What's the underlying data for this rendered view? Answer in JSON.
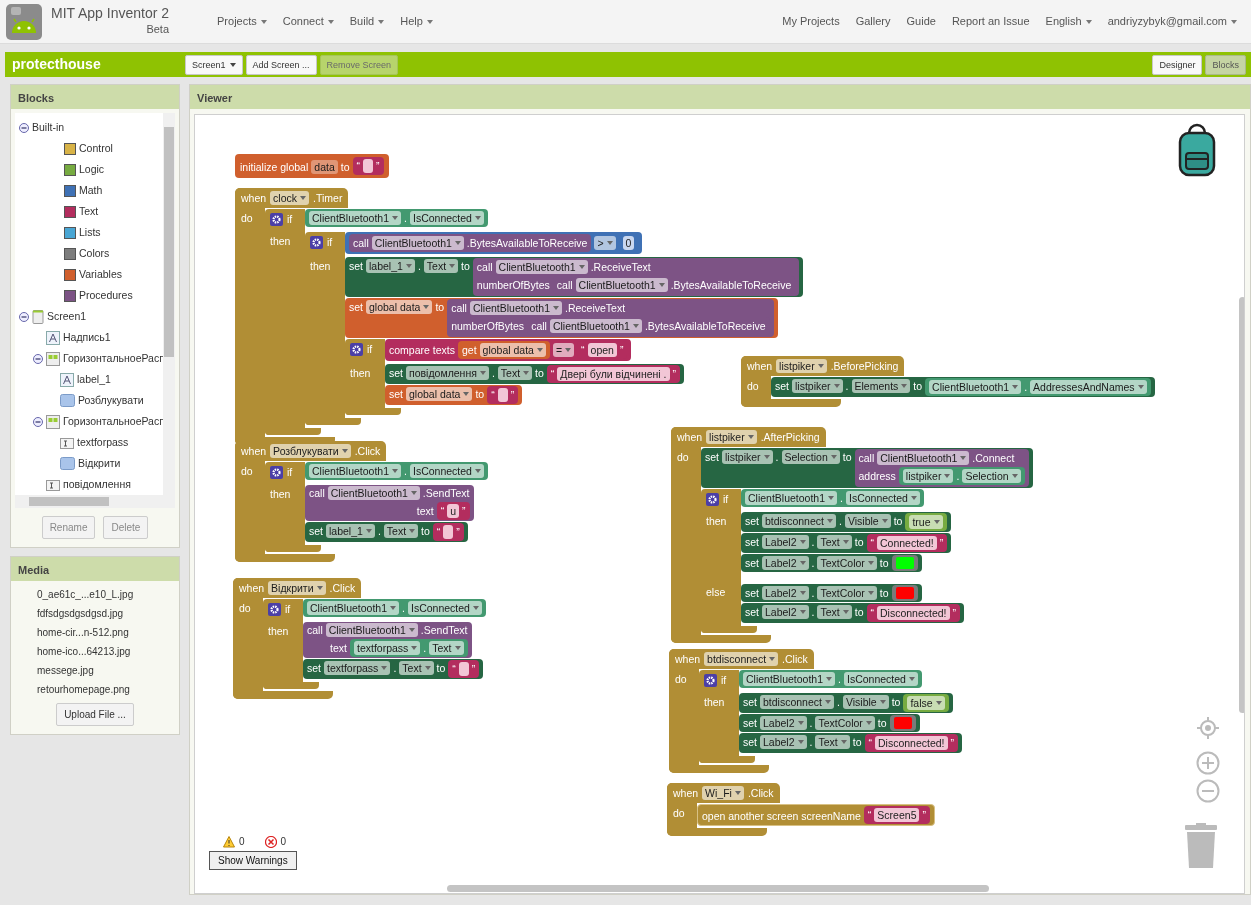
{
  "nav": {
    "title": "MIT App Inventor 2",
    "subtitle": "Beta",
    "menus": [
      {
        "label": "Projects",
        "kind": "menu"
      },
      {
        "label": "Connect",
        "kind": "menu"
      },
      {
        "label": "Build",
        "kind": "menu"
      },
      {
        "label": "Help",
        "kind": "menu"
      }
    ],
    "links": [
      {
        "label": "My Projects",
        "kind": "link"
      },
      {
        "label": "Gallery",
        "kind": "link"
      },
      {
        "label": "Guide",
        "kind": "link"
      },
      {
        "label": "Report an Issue",
        "kind": "link"
      },
      {
        "label": "English",
        "kind": "menu"
      },
      {
        "label": "andriyzybyk@gmail.com",
        "kind": "menu"
      }
    ]
  },
  "project_bar": {
    "name": "protecthouse",
    "screen_buttons": [
      {
        "label": "Screen1",
        "kind": "menu",
        "disabled": false
      },
      {
        "label": "Add Screen ...",
        "kind": "button",
        "disabled": false
      },
      {
        "label": "Remove Screen",
        "kind": "button",
        "disabled": true
      }
    ],
    "views": [
      {
        "label": "Designer",
        "selected": false
      },
      {
        "label": "Blocks",
        "selected": true
      }
    ]
  },
  "blocks_panel": {
    "title": "Blocks",
    "tree": [
      {
        "label": "Built-in",
        "kind": "folder",
        "expanded": true,
        "children": [
          {
            "label": "Control",
            "kind": "category",
            "color": "#d8b347"
          },
          {
            "label": "Logic",
            "kind": "category",
            "color": "#77ab41"
          },
          {
            "label": "Math",
            "kind": "category",
            "color": "#3f71b5"
          },
          {
            "label": "Text",
            "kind": "category",
            "color": "#b32d5e"
          },
          {
            "label": "Lists",
            "kind": "category",
            "color": "#49a6d4"
          },
          {
            "label": "Colors",
            "kind": "category",
            "color": "#7d7d7d"
          },
          {
            "label": "Variables",
            "kind": "category",
            "color": "#d05f2d"
          },
          {
            "label": "Procedures",
            "kind": "category",
            "color": "#7c5385"
          }
        ]
      },
      {
        "label": "Screen1",
        "kind": "screen",
        "expanded": true,
        "children": [
          {
            "label": "Надпись1",
            "kind": "label"
          },
          {
            "label": "ГоризонтальноеРасп",
            "kind": "arrangement",
            "expanded": true,
            "children": [
              {
                "label": "label_1",
                "kind": "label"
              },
              {
                "label": "Розблукувати",
                "kind": "button"
              }
            ]
          },
          {
            "label": "ГоризонтальноеРасп",
            "kind": "arrangement",
            "expanded": true,
            "children": [
              {
                "label": "textforpass",
                "kind": "textbox"
              },
              {
                "label": "Відкрити",
                "kind": "button"
              }
            ]
          },
          {
            "label": "повідомлення",
            "kind": "textbox"
          }
        ]
      }
    ],
    "buttons": [
      {
        "label": "Rename",
        "disabled": true
      },
      {
        "label": "Delete",
        "disabled": true
      }
    ]
  },
  "media": {
    "title": "Media",
    "files": [
      "0_ae61c_...e10_L.jpg",
      "fdfsdgsdgsdgsd.jpg",
      "home-cir...n-512.png",
      "home-ico...64213.jpg",
      "messege.jpg",
      "retourhomepage.png"
    ],
    "upload": "Upload File ..."
  },
  "viewer": {
    "title": "Viewer",
    "blocks": [
      {
        "kind": "global_init",
        "label": "initialize global",
        "name": "data",
        "to": "to",
        "value": {
          "kind": "text",
          "lq": "“",
          "rq": "”"
        }
      },
      {
        "kind": "event",
        "when": "when",
        "component": "clock",
        "event": ".Timer",
        "do": "do",
        "body": [
          {
            "kind": "if",
            "if": "if",
            "cond": {
              "kind": "getter",
              "component": "ClientBluetooth1",
              "dot": ".",
              "property": "IsConnected"
            },
            "then_label": "then",
            "then": [
              {
                "kind": "if",
                "if": "if",
                "cond": {
                  "kind": "math_compare",
                  "left": {
                    "kind": "call",
                    "call": "call",
                    "component": "ClientBluetooth1",
                    "method": ".BytesAvailableToReceive"
                  },
                  "op": ">",
                  "right": {
                    "kind": "number",
                    "value": "0"
                  }
                },
                "then_label": "then",
                "then": [
                  {
                    "kind": "set",
                    "set": "set",
                    "component": "label_1",
                    "dot": ".",
                    "property": "Text",
                    "to": "to",
                    "value": {
                      "kind": "call",
                      "call": "call",
                      "component": "ClientBluetooth1",
                      "method": ".ReceiveText",
                      "args": [
                        {
                          "name": "numberOfBytes",
                          "value": {
                            "kind": "call",
                            "call": "call",
                            "component": "ClientBluetooth1",
                            "method": ".BytesAvailableToReceive"
                          }
                        }
                      ]
                    }
                  },
                  {
                    "kind": "set_global",
                    "set": "set",
                    "name": "global data",
                    "to": "to",
                    "value": {
                      "kind": "call",
                      "call": "call",
                      "component": "ClientBluetooth1",
                      "method": ".ReceiveText",
                      "args": [
                        {
                          "name": "numberOfBytes",
                          "value": {
                            "kind": "call",
                            "call": "call",
                            "component": "ClientBluetooth1",
                            "method": ".BytesAvailableToReceive"
                          }
                        }
                      ]
                    }
                  },
                  {
                    "kind": "if",
                    "if": "if",
                    "cond": {
                      "kind": "compare_texts",
                      "label": "compare texts",
                      "left": {
                        "kind": "get_global",
                        "get": "get",
                        "name": "global data"
                      },
                      "op": "=",
                      "right": {
                        "kind": "text",
                        "lq": "“",
                        "value": "open",
                        "rq": "”"
                      }
                    },
                    "then_label": "then",
                    "then": [
                      {
                        "kind": "set",
                        "set": "set",
                        "component": "повідомлення",
                        "dot": ".",
                        "property": "Text",
                        "to": "to",
                        "value": {
                          "kind": "text",
                          "lq": "“",
                          "value": "Двері були відчинені .",
                          "rq": "”"
                        }
                      },
                      {
                        "kind": "set_global",
                        "set": "set",
                        "name": "global data",
                        "to": "to",
                        "value": {
                          "kind": "text",
                          "lq": "“",
                          "rq": "”"
                        }
                      }
                    ]
                  }
                ]
              }
            ]
          }
        ]
      },
      {
        "kind": "event",
        "when": "when",
        "component": "Розблукувати",
        "event": ".Click",
        "do": "do",
        "body": [
          {
            "kind": "if",
            "if": "if",
            "cond": {
              "kind": "getter",
              "component": "ClientBluetooth1",
              "dot": ".",
              "property": "IsConnected"
            },
            "then_label": "then",
            "then": [
              {
                "kind": "call",
                "call": "call",
                "component": "ClientBluetooth1",
                "method": ".SendText",
                "args": [
                  {
                    "name": "text",
                    "value": {
                      "kind": "text",
                      "lq": "“",
                      "value": "u",
                      "rq": "”"
                    }
                  }
                ]
              },
              {
                "kind": "set",
                "set": "set",
                "component": "label_1",
                "dot": ".",
                "property": "Text",
                "to": "to",
                "value": {
                  "kind": "text",
                  "lq": "“",
                  "rq": "”"
                }
              }
            ]
          }
        ]
      },
      {
        "kind": "event",
        "when": "when",
        "component": "Відкрити",
        "event": ".Click",
        "do": "do",
        "body": [
          {
            "kind": "if",
            "if": "if",
            "cond": {
              "kind": "getter",
              "component": "ClientBluetooth1",
              "dot": ".",
              "property": "IsConnected"
            },
            "then_label": "then",
            "then": [
              {
                "kind": "call",
                "call": "call",
                "component": "ClientBluetooth1",
                "method": ".SendText",
                "args": [
                  {
                    "name": "text",
                    "value": {
                      "kind": "getter",
                      "component": "textforpass",
                      "dot": ".",
                      "property": "Text"
                    }
                  }
                ]
              },
              {
                "kind": "set",
                "set": "set",
                "component": "textforpass",
                "dot": ".",
                "property": "Text",
                "to": "to",
                "value": {
                  "kind": "text",
                  "lq": "“",
                  "rq": "”"
                }
              }
            ]
          }
        ]
      },
      {
        "kind": "event",
        "when": "when",
        "component": "listpiker",
        "event": ".BeforePicking",
        "do": "do",
        "body": [
          {
            "kind": "set",
            "set": "set",
            "component": "listpiker",
            "dot": ".",
            "property": "Elements",
            "to": "to",
            "value": {
              "kind": "getter",
              "component": "ClientBluetooth1",
              "dot": ".",
              "property": "AddressesAndNames"
            }
          }
        ]
      },
      {
        "kind": "event",
        "when": "when",
        "component": "listpiker",
        "event": ".AfterPicking",
        "do": "do",
        "body": [
          {
            "kind": "set",
            "set": "set",
            "component": "listpiker",
            "dot": ".",
            "property": "Selection",
            "to": "to",
            "value": {
              "kind": "call",
              "call": "call",
              "component": "ClientBluetooth1",
              "method": ".Connect",
              "args": [
                {
                  "name": "address",
                  "value": {
                    "kind": "getter",
                    "component": "listpiker",
                    "dot": ".",
                    "property": "Selection"
                  }
                }
              ]
            }
          },
          {
            "kind": "if",
            "if": "if",
            "cond": {
              "kind": "getter",
              "component": "ClientBluetooth1",
              "dot": ".",
              "property": "IsConnected"
            },
            "then_label": "then",
            "then": [
              {
                "kind": "set",
                "set": "set",
                "component": "btdisconnect",
                "dot": ".",
                "property": "Visible",
                "to": "to",
                "value": {
                  "kind": "bool",
                  "value": "true"
                }
              },
              {
                "kind": "set",
                "set": "set",
                "component": "Label2",
                "dot": ".",
                "property": "Text",
                "to": "to",
                "value": {
                  "kind": "text",
                  "lq": "“",
                  "value": "Connected!",
                  "rq": "”"
                }
              },
              {
                "kind": "set",
                "set": "set",
                "component": "Label2",
                "dot": ".",
                "property": "TextColor",
                "to": "to",
                "value": {
                  "kind": "color",
                  "color": "#00ff00"
                }
              }
            ],
            "else_label": "else",
            "else": [
              {
                "kind": "set",
                "set": "set",
                "component": "Label2",
                "dot": ".",
                "property": "TextColor",
                "to": "to",
                "value": {
                  "kind": "color",
                  "color": "#ff0000"
                }
              },
              {
                "kind": "set",
                "set": "set",
                "component": "Label2",
                "dot": ".",
                "property": "Text",
                "to": "to",
                "value": {
                  "kind": "text",
                  "lq": "“",
                  "value": "Disconnected!",
                  "rq": "”"
                }
              }
            ]
          }
        ]
      },
      {
        "kind": "event",
        "when": "when",
        "component": "btdisconnect",
        "event": ".Click",
        "do": "do",
        "body": [
          {
            "kind": "if",
            "if": "if",
            "cond": {
              "kind": "getter",
              "component": "ClientBluetooth1",
              "dot": ".",
              "property": "IsConnected"
            },
            "then_label": "then",
            "then": [
              {
                "kind": "set",
                "set": "set",
                "component": "btdisconnect",
                "dot": ".",
                "property": "Visible",
                "to": "to",
                "value": {
                  "kind": "bool",
                  "value": "false"
                }
              },
              {
                "kind": "set",
                "set": "set",
                "component": "Label2",
                "dot": ".",
                "property": "TextColor",
                "to": "to",
                "value": {
                  "kind": "color",
                  "color": "#ff0000"
                }
              },
              {
                "kind": "set",
                "set": "set",
                "component": "Label2",
                "dot": ".",
                "property": "Text",
                "to": "to",
                "value": {
                  "kind": "text",
                  "lq": "“",
                  "value": "Disconnected!",
                  "rq": "”"
                }
              }
            ]
          }
        ]
      },
      {
        "kind": "event",
        "when": "when",
        "component": "Wi_Fi",
        "event": ".Click",
        "do": "do",
        "body": [
          {
            "kind": "open_screen",
            "label": "open another screen",
            "arg": "screenName",
            "value": {
              "kind": "text",
              "lq": "“",
              "value": "Screen5",
              "rq": "”"
            }
          }
        ]
      }
    ],
    "warnings": "0",
    "errors": "0",
    "show_warnings": "Show Warnings"
  }
}
